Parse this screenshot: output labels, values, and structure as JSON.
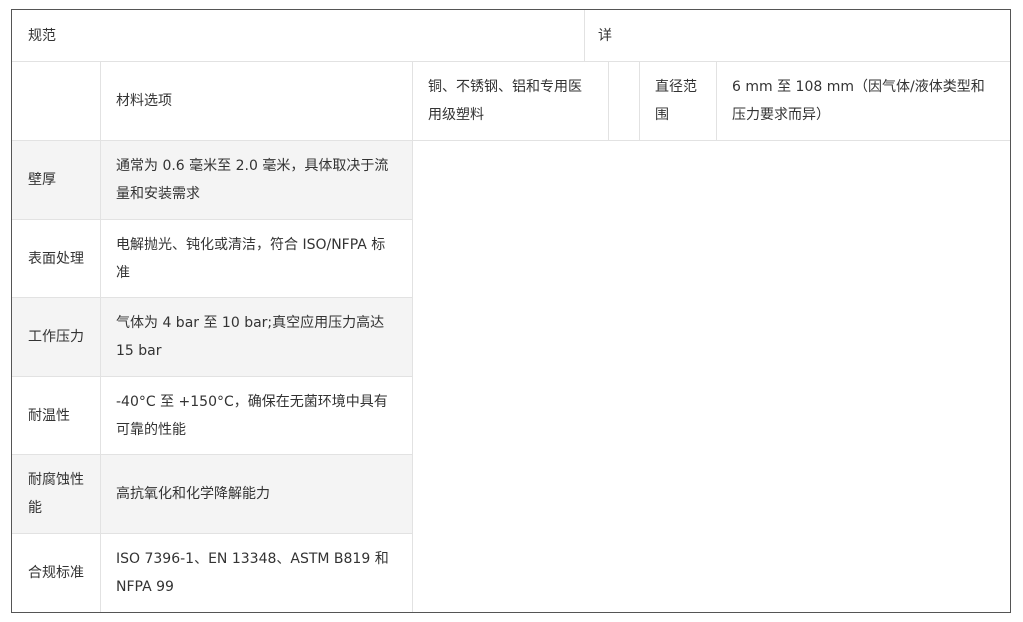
{
  "header": {
    "spec_label": "规范",
    "detail_label": "详"
  },
  "row1": {
    "label": "",
    "item": "材料选项",
    "materials": "铜、不锈钢、铝和专用医用级塑料",
    "blank": "",
    "diameter_label": "直径范围",
    "diameter_value": "6 mm 至 108 mm（因气体/液体类型和压力要求而异）"
  },
  "rows": [
    {
      "name": "壁厚",
      "value": "通常为 0.6 毫米至 2.0 毫米，具体取决于流量和安装需求"
    },
    {
      "name": "表面处理",
      "value": "电解抛光、钝化或清洁，符合 ISO/NFPA 标准"
    },
    {
      "name": "工作压力",
      "value": "气体为 4 bar 至 10 bar;真空应用压力高达 15 bar"
    },
    {
      "name": "耐温性",
      "value": "-40°C 至 +150°C，确保在无菌环境中具有可靠的性能"
    },
    {
      "name": "耐腐蚀性能",
      "value": "高抗氧化和化学降解能力"
    },
    {
      "name": "合规标准",
      "value": "ISO 7396-1、EN 13348、ASTM B819 和 NFPA 99"
    }
  ]
}
